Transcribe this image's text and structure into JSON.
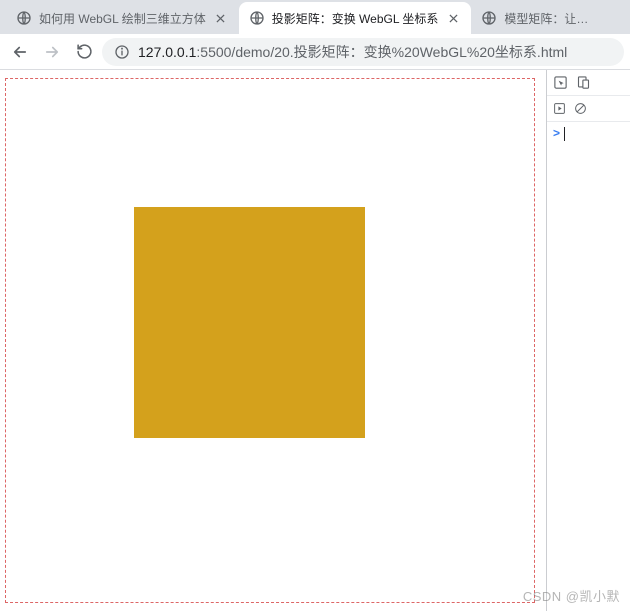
{
  "tabs": [
    {
      "title": "如何用 WebGL 绘制三维立方体",
      "active": false
    },
    {
      "title": "投影矩阵：变换 WebGL 坐标系",
      "active": true
    },
    {
      "title": "模型矩阵：让立方体旋",
      "active": false
    }
  ],
  "addressbar": {
    "host": "127.0.0.1",
    "port_path": ":5500/demo/20.投影矩阵：变换%20WebGL%20坐标系.html"
  },
  "console": {
    "prompt": ">"
  },
  "watermark": "CSDN @凯小默",
  "colors": {
    "square": "#d4a11c",
    "canvas_border": "#d66"
  }
}
